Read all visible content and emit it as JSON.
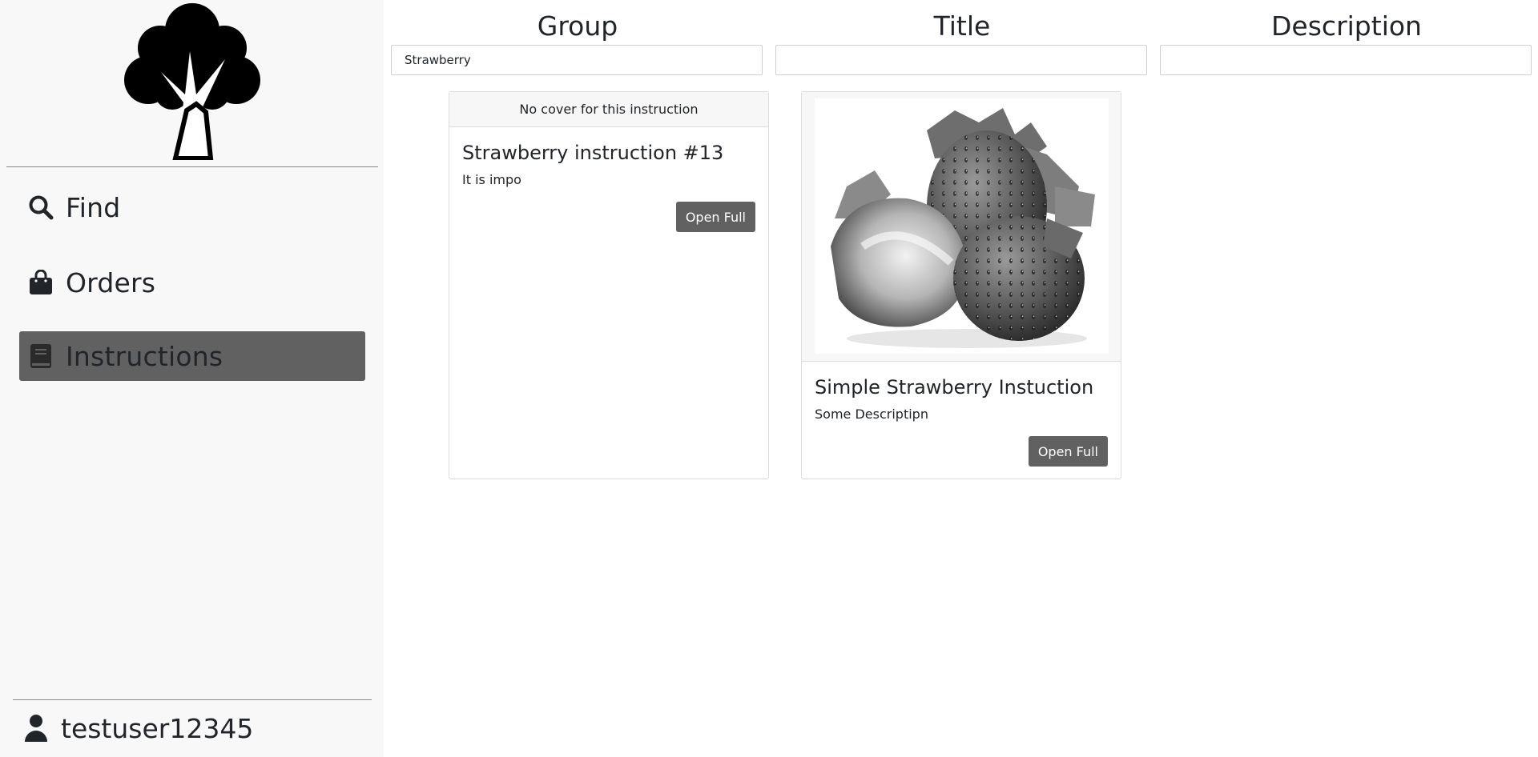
{
  "sidebar": {
    "logo_icon": "tree-icon",
    "nav": [
      {
        "label": "Find",
        "icon": "search-icon",
        "active": false
      },
      {
        "label": "Orders",
        "icon": "shopping-bag-icon",
        "active": false
      },
      {
        "label": "Instructions",
        "icon": "book-icon",
        "active": true
      }
    ],
    "user": {
      "label": "testuser12345",
      "icon": "user-icon"
    }
  },
  "filters": {
    "group": {
      "header": "Group",
      "value": "Strawberry"
    },
    "title": {
      "header": "Title",
      "value": ""
    },
    "description": {
      "header": "Description",
      "value": ""
    }
  },
  "cards": [
    {
      "cover_text": "No cover for this instruction",
      "title": "Strawberry instruction #13",
      "description": "It is impo",
      "button": "Open Full"
    },
    {
      "image": "strawberries-photo",
      "title": "Simple Strawberry Instuction",
      "description": "Some Descriptipn",
      "button": "Open Full"
    }
  ],
  "colors": {
    "sidebar_bg": "#f8f8f8",
    "active_nav_bg": "#616161",
    "button_bg": "#616161"
  }
}
